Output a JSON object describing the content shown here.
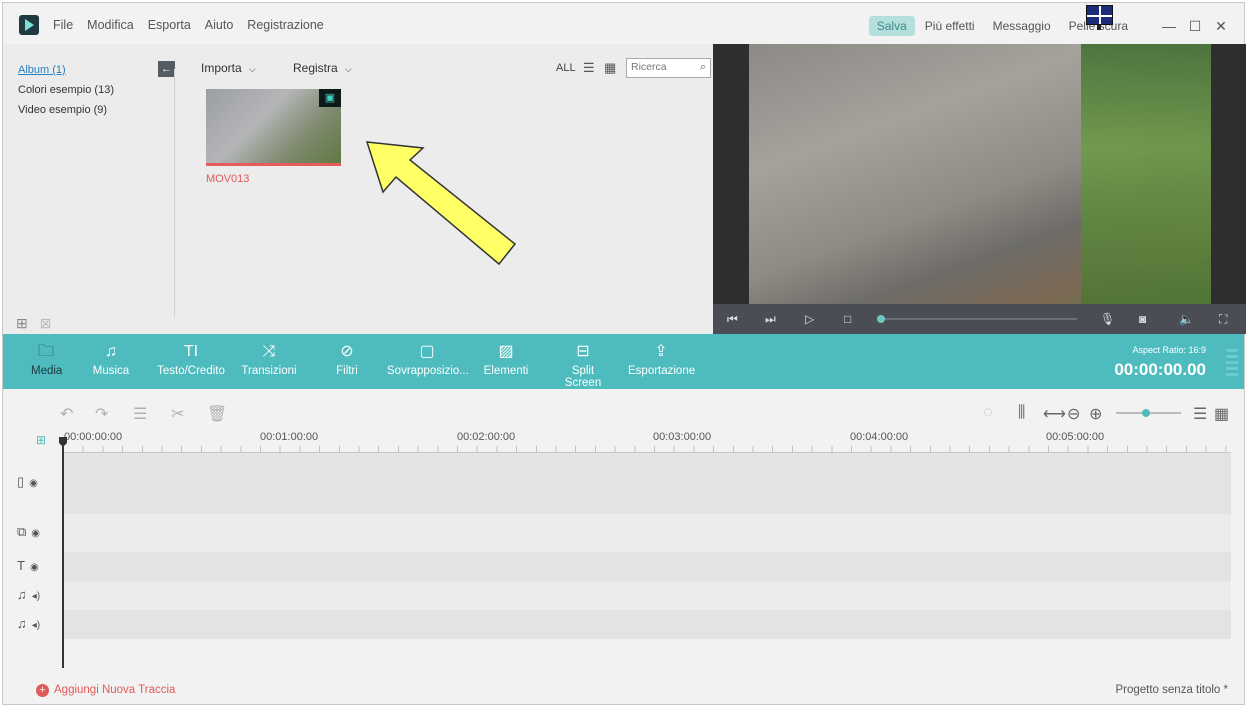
{
  "menu": [
    "File",
    "Modifica",
    "Esporta",
    "Aiuto",
    "Registrazione"
  ],
  "topbar": {
    "save": "Salva",
    "more_effects": "Più effetti",
    "message": "Messaggio",
    "dark_skin": "Pelle scura"
  },
  "library": {
    "albums": [
      "Album (1)",
      "Colori esempio (13)",
      "Video esempio (9)"
    ],
    "import": "Importa",
    "record": "Registra",
    "all": "ALL",
    "search_placeholder": "Ricerca",
    "clip_name": "MOV013"
  },
  "toolbar": {
    "items": [
      "Media",
      "Musica",
      "Testo/Credito",
      "Transizioni",
      "Filtri",
      "Sovrapposizio...",
      "Elementi",
      "Split Screen",
      "Esportazione"
    ],
    "aspect": "Aspect Ratio: 16:9",
    "timecode": "00:00:00.00"
  },
  "timeline": {
    "ruler": [
      "00:00:00:00",
      "00:01:00:00",
      "00:02:00:00",
      "00:03:00:00",
      "00:04:00:00",
      "00:05:00:00"
    ],
    "add_track": "Aggiungi Nuova Traccia",
    "project": "Progetto senza titolo *"
  },
  "colors": {
    "accent": "#4ebcbe",
    "clip_label": "#e05a5a",
    "annotation_arrow": "#ffff66"
  }
}
